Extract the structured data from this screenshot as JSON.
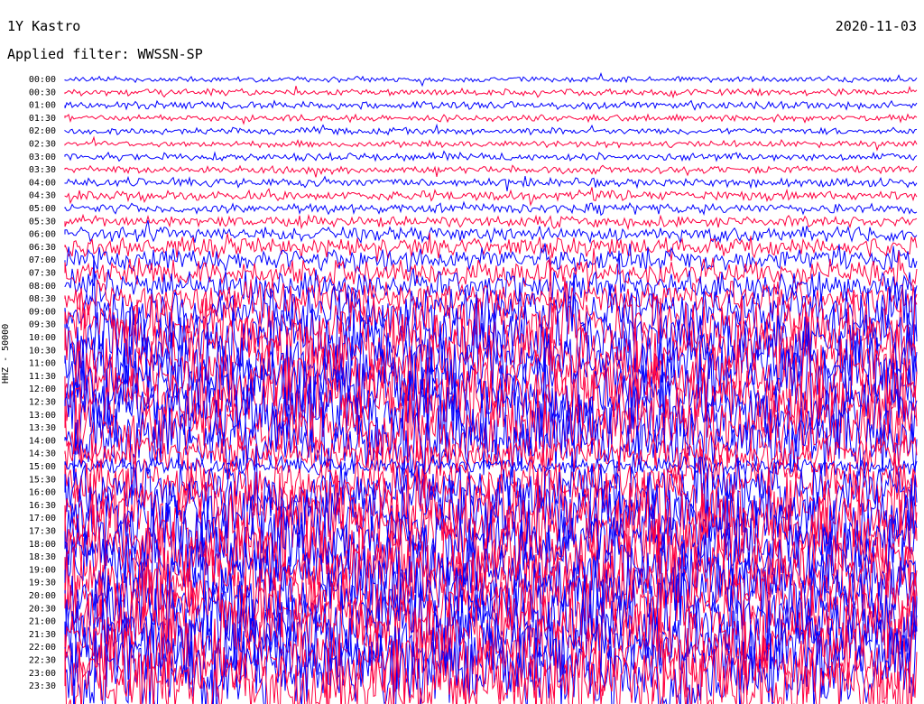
{
  "header": {
    "station": "1Y Kastro",
    "filter": "Applied filter: WWSSN-SP",
    "date": "2020-11-03"
  },
  "chart_data": {
    "type": "line",
    "title": "1Y Kastro",
    "subtitle": "Applied filter: WWSSN-SP",
    "ylabel": "HHZ - 50000",
    "xlabel": "",
    "categories": [
      "00:00",
      "00:30",
      "01:00",
      "01:30",
      "02:00",
      "02:30",
      "03:00",
      "03:30",
      "04:00",
      "04:30",
      "05:00",
      "05:30",
      "06:00",
      "06:30",
      "07:00",
      "07:30",
      "08:00",
      "08:30",
      "09:00",
      "09:30",
      "10:00",
      "10:30",
      "11:00",
      "11:30",
      "12:00",
      "12:30",
      "13:00",
      "13:30",
      "14:00",
      "14:30",
      "15:00",
      "15:30",
      "16:00",
      "16:30",
      "17:00",
      "17:30",
      "18:00",
      "18:30",
      "19:00",
      "19:30",
      "20:00",
      "20:30",
      "21:00",
      "21:30",
      "22:00",
      "22:30",
      "23:00",
      "23:30"
    ],
    "series": [
      {
        "color": "#0000ff"
      },
      {
        "color": "#ff0040"
      }
    ],
    "relative_amplitude": [
      0.25,
      0.3,
      0.35,
      0.3,
      0.3,
      0.3,
      0.35,
      0.35,
      0.4,
      0.45,
      0.45,
      0.5,
      0.7,
      0.9,
      1.1,
      1.2,
      1.4,
      1.6,
      2.4,
      2.8,
      3.0,
      3.2,
      3.2,
      3.3,
      3.3,
      3.4,
      3.4,
      3.4,
      3.3,
      1.8,
      0.8,
      2.2,
      3.0,
      3.4,
      3.6,
      3.6,
      3.6,
      3.6,
      3.6,
      3.6,
      3.6,
      3.6,
      3.6,
      3.6,
      3.6,
      3.6,
      3.7,
      3.8
    ]
  }
}
